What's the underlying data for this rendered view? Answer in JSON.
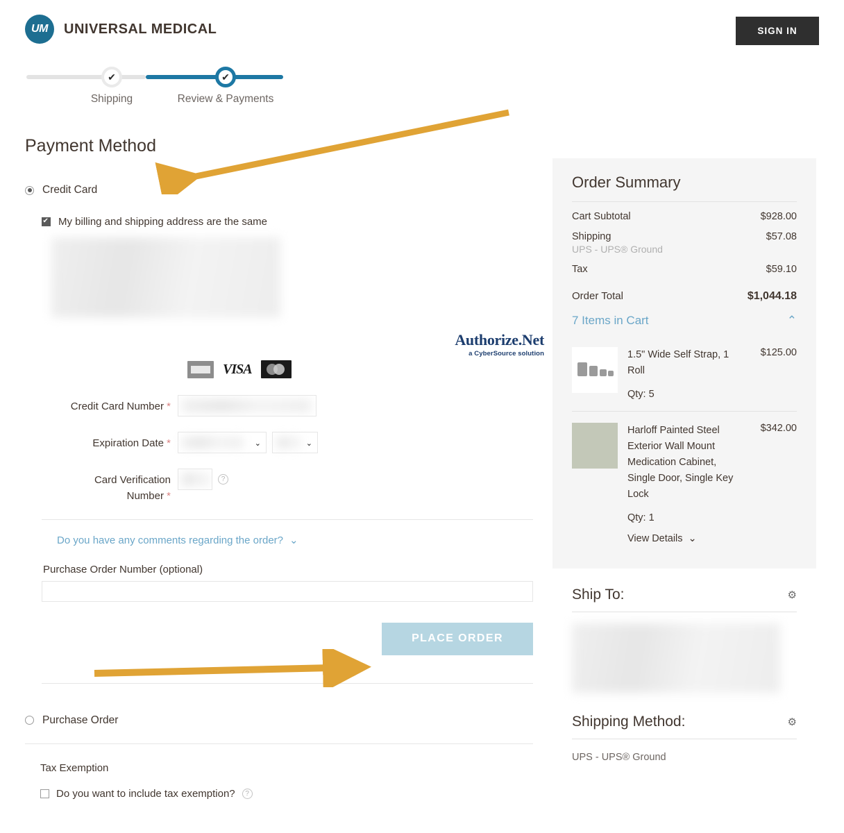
{
  "header": {
    "logo_text": "UM",
    "brand_name": "UNIVERSAL MEDICAL",
    "signin_label": "SIGN IN"
  },
  "progress": {
    "steps": [
      {
        "label": "Shipping",
        "state": "completed",
        "check": "✔"
      },
      {
        "label": "Review & Payments",
        "state": "active",
        "check": "✔"
      }
    ],
    "active_color": "#1d78a4",
    "inactive_color": "#e3e3e3"
  },
  "payment": {
    "title": "Payment Method",
    "credit_card_label": "Credit Card",
    "billing_same_label": "My billing and shipping address are the same",
    "authorize_net": {
      "main": "Authorize.Net",
      "sub": "a CyberSource solution"
    },
    "card_brands": [
      "american-express",
      "visa",
      "mastercard"
    ],
    "fields": [
      {
        "label": "Credit Card Number",
        "required": "*"
      },
      {
        "label": "Expiration Date",
        "required": "*"
      },
      {
        "label": "Card Verification Number",
        "required": "*"
      }
    ],
    "cc_number_label": "Credit Card Number",
    "exp_date_label": "Expiration Date",
    "cvv_label_line1": "Card Verification",
    "cvv_label_line2": "Number",
    "required_mark": "*",
    "comments_link": "Do you have any comments regarding the order?",
    "po_number_label": "Purchase Order Number (optional)",
    "po_number_value": "",
    "place_order_label": "PLACE ORDER",
    "place_order_color": "#b6d6e2",
    "purchase_order_label": "Purchase Order",
    "tax_exemption_title": "Tax Exemption",
    "tax_exemption_label": "Do you want to include tax exemption?"
  },
  "order_summary": {
    "title": "Order Summary",
    "rows": [
      {
        "label": "Cart Subtotal",
        "value": "$928.00",
        "sub": ""
      },
      {
        "label": "Shipping",
        "value": "$57.08",
        "sub": "UPS - UPS® Ground"
      },
      {
        "label": "Tax",
        "value": "$59.10",
        "sub": ""
      }
    ],
    "total_label": "Order Total",
    "total_value": "$1,044.18",
    "items_toggle_label": "7 Items in Cart",
    "items": [
      {
        "name": "1.5\" Wide Self Strap, 1 Roll",
        "price": "$125.00",
        "qty": "Qty: 5",
        "view_details": ""
      },
      {
        "name": "Harloff Painted Steel Exterior Wall Mount Medication Cabinet, Single Door, Single Key Lock",
        "price": "$342.00",
        "qty": "Qty: 1",
        "view_details": "View Details"
      }
    ]
  },
  "ship_to": {
    "title": "Ship To:",
    "address_redacted": true
  },
  "shipping_method": {
    "title": "Shipping Method:",
    "value": "UPS - UPS® Ground"
  },
  "annotations": {
    "arrow_color": "#e0a335",
    "arrow_payment_target": "Credit Card",
    "arrow_place_order_target": "PLACE ORDER"
  }
}
